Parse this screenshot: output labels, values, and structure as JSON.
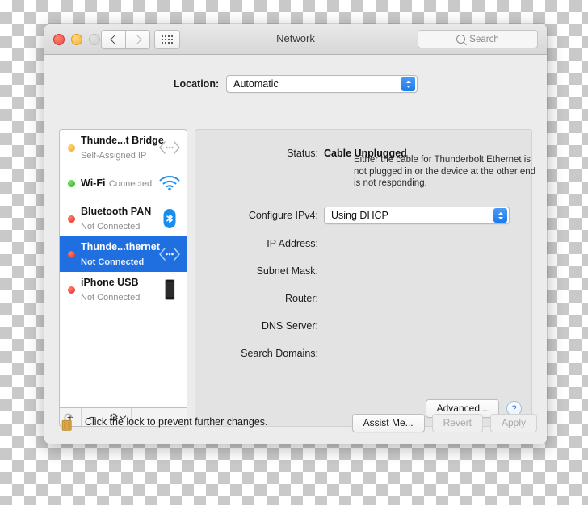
{
  "window": {
    "title": "Network",
    "traffic_lights": [
      "close",
      "minimize",
      "zoom"
    ],
    "search_placeholder": "Search"
  },
  "location": {
    "label": "Location:",
    "value": "Automatic"
  },
  "services": [
    {
      "name": "Thunde...t Bridge",
      "state": "Self-Assigned IP",
      "dot": "amber",
      "icon": "thunderbolt-icon",
      "selected": false
    },
    {
      "name": "Wi-Fi",
      "state": "Connected",
      "dot": "green",
      "icon": "wifi-icon",
      "selected": false
    },
    {
      "name": "Bluetooth PAN",
      "state": "Not Connected",
      "dot": "red",
      "icon": "bluetooth-icon",
      "selected": false
    },
    {
      "name": "Thunde...thernet",
      "state": "Not Connected",
      "dot": "red",
      "icon": "thunderbolt-icon",
      "selected": true
    },
    {
      "name": "iPhone USB",
      "state": "Not Connected",
      "dot": "red",
      "icon": "iphone-icon",
      "selected": false
    }
  ],
  "list_toolbar": {
    "add": "+",
    "remove": "−",
    "actions": "⚙"
  },
  "detail": {
    "status_label": "Status:",
    "status_value": "Cable Unplugged",
    "status_description": "Either the cable for Thunderbolt Ethernet is not plugged in or the device at the other end is not responding.",
    "configure_label": "Configure IPv4:",
    "configure_value": "Using DHCP",
    "fields": [
      {
        "label": "IP Address:",
        "value": ""
      },
      {
        "label": "Subnet Mask:",
        "value": ""
      },
      {
        "label": "Router:",
        "value": ""
      },
      {
        "label": "DNS Server:",
        "value": ""
      },
      {
        "label": "Search Domains:",
        "value": ""
      }
    ],
    "advanced_label": "Advanced...",
    "help_label": "?"
  },
  "footer": {
    "lock_text": "Click the lock to prevent further changes.",
    "assist_label": "Assist Me...",
    "revert_label": "Revert",
    "apply_label": "Apply"
  },
  "colors": {
    "selection_blue": "#1f6fe0",
    "accent_blue": "#1a7ced",
    "status_green": "#2fac1f",
    "status_amber": "#f0a81c",
    "status_red": "#e8291c"
  }
}
